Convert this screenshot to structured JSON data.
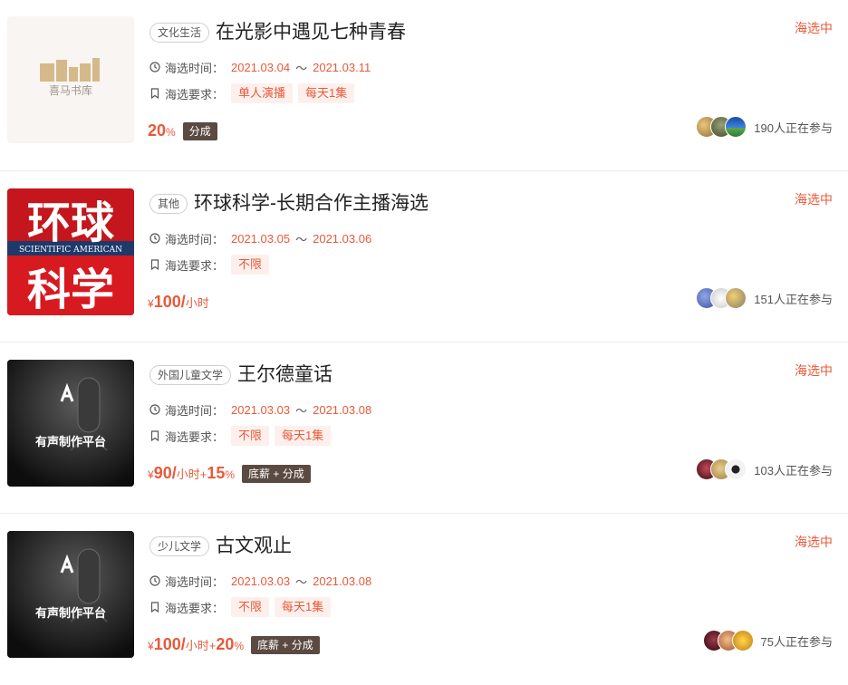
{
  "items": [
    {
      "tag": "文化生活",
      "title": "在光影中遇见七种青春",
      "status": "海选中",
      "time_label": "海选时间：",
      "date_start": "2021.03.04",
      "tilde": "～",
      "date_end": "2021.03.11",
      "req_label": "海选要求：",
      "requirements": [
        "单人演播",
        "每天1集"
      ],
      "price_main": "20",
      "price_suffix": "%",
      "price_unit": "",
      "price_extra_main": "",
      "price_extra_suffix": "",
      "share_badge": "分成",
      "participants": "190人正在参与",
      "cover_text": "喜马书库",
      "avatar_colors": [
        "#c9a45c",
        "#6b7a4e",
        "#2e6fc2"
      ]
    },
    {
      "tag": "其他",
      "title": "环球科学-长期合作主播海选",
      "status": "海选中",
      "time_label": "海选时间：",
      "date_start": "2021.03.05",
      "tilde": "～",
      "date_end": "2021.03.06",
      "req_label": "海选要求：",
      "requirements": [
        "不限"
      ],
      "price_currency": "¥",
      "price_main": "100/",
      "price_suffix": "小时",
      "price_extra_main": "",
      "price_extra_suffix": "",
      "share_badge": "",
      "participants": "151人正在参与",
      "cover_text_1": "环球",
      "cover_text_2": "科学",
      "cover_banner": "SCIENTIFIC AMERICAN",
      "avatar_colors": [
        "#5b79c9",
        "#d8d8d8",
        "#e1b94a"
      ]
    },
    {
      "tag": "外国儿童文学",
      "title": "王尔德童话",
      "status": "海选中",
      "time_label": "海选时间：",
      "date_start": "2021.03.03",
      "tilde": "～",
      "date_end": "2021.03.08",
      "req_label": "海选要求：",
      "requirements": [
        "不限",
        "每天1集"
      ],
      "price_currency": "¥",
      "price_main": "90/",
      "price_suffix": "小时+",
      "price_extra_main": "15",
      "price_extra_suffix": "%",
      "share_badge": "底薪 + 分成",
      "participants": "103人正在参与",
      "cover_text": "有声制作平台",
      "avatar_colors": [
        "#8a2a3a",
        "#c9a35a",
        "#e8e8e8"
      ]
    },
    {
      "tag": "少儿文学",
      "title": "古文观止",
      "status": "海选中",
      "time_label": "海选时间：",
      "date_start": "2021.03.03",
      "tilde": "～",
      "date_end": "2021.03.08",
      "req_label": "海选要求：",
      "requirements": [
        "不限",
        "每天1集"
      ],
      "price_currency": "¥",
      "price_main": "100/",
      "price_suffix": "小时+",
      "price_extra_main": "20",
      "price_extra_suffix": "%",
      "share_badge": "底薪 + 分成",
      "participants": "75人正在参与",
      "cover_text": "有声制作平台",
      "avatar_colors": [
        "#6a1f2f",
        "#d98a4a",
        "#e6b020"
      ]
    }
  ],
  "colors": {
    "accent": "#e8593a",
    "chip_bg": "#fdf0ec",
    "badge_bg": "#5a4a41"
  }
}
